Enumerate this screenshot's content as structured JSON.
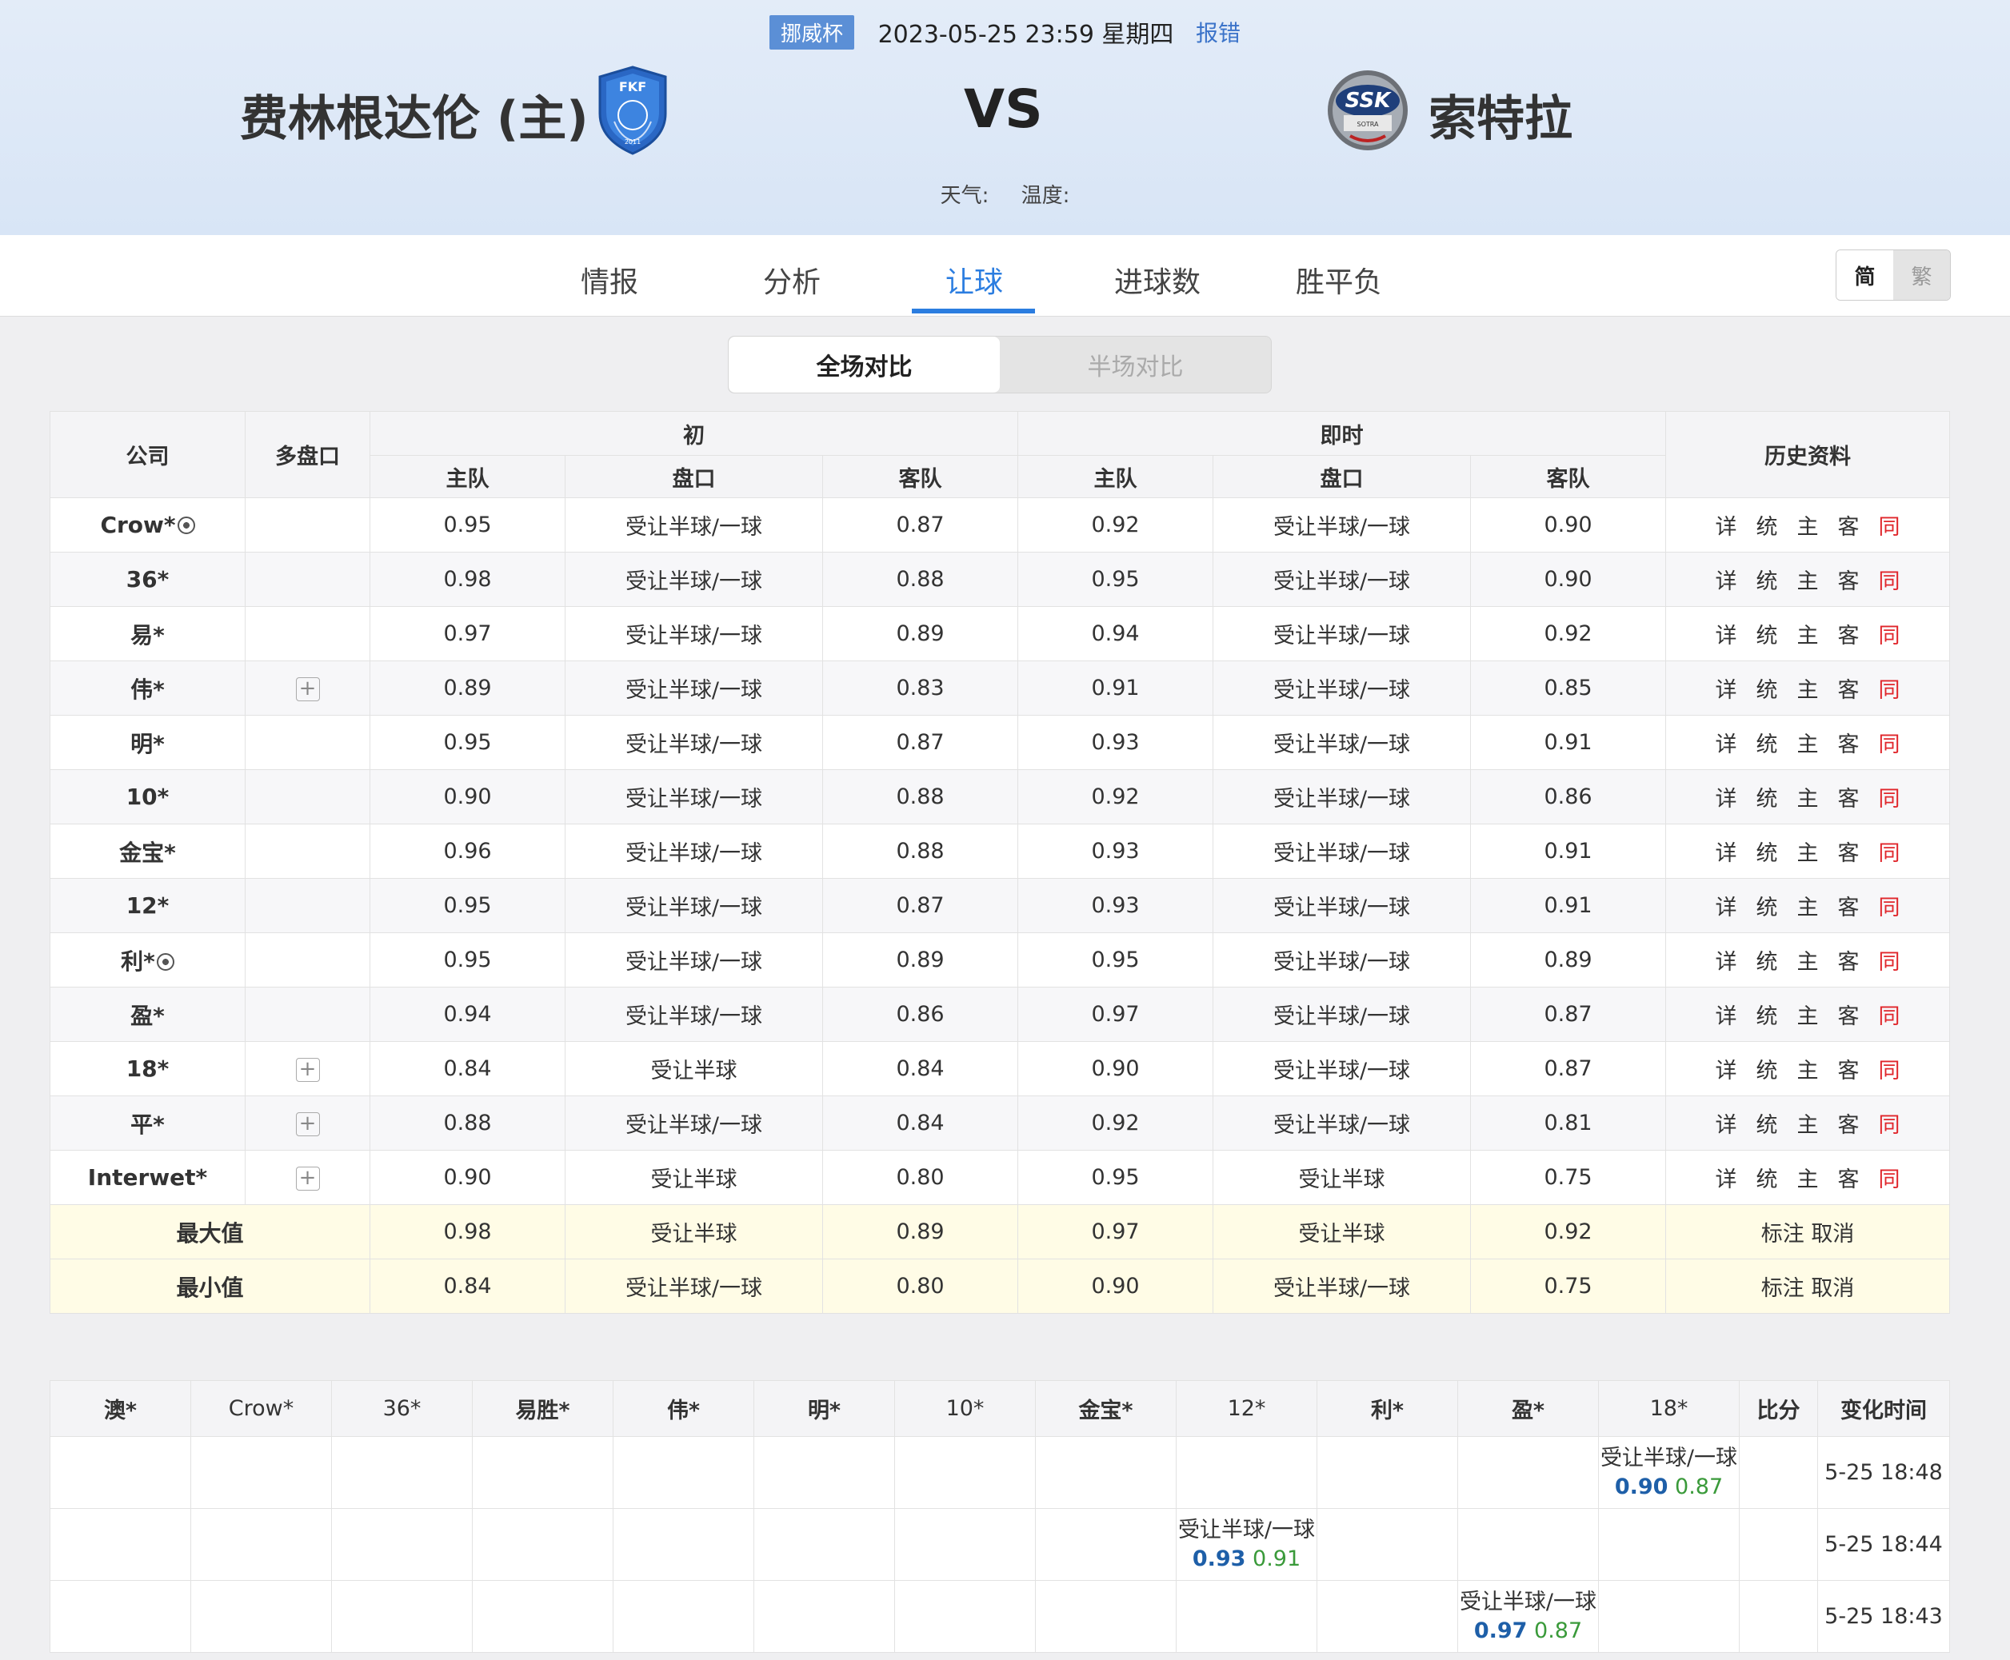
{
  "header": {
    "league": "挪威杯",
    "datetime": "2023-05-25 23:59 星期四",
    "report": "报错",
    "home_team": "费林根达伦 (主)",
    "away_team": "索特拉",
    "vs": "VS",
    "weather_label": "天气:",
    "temperature_label": "温度:"
  },
  "tabs": [
    "情报",
    "分析",
    "让球",
    "进球数",
    "胜平负"
  ],
  "active_tab": "让球",
  "lang": {
    "simplified": "简",
    "traditional": "繁"
  },
  "segment": {
    "full": "全场对比",
    "half": "半场对比"
  },
  "main_table": {
    "headers": {
      "company": "公司",
      "multi": "多盘口",
      "initial": "初",
      "live": "即时",
      "history": "历史资料",
      "home": "主队",
      "line": "盘口",
      "away": "客队"
    },
    "history_links": [
      "详",
      "统",
      "主",
      "客",
      "同"
    ],
    "rows": [
      {
        "company": "Crow*",
        "ball": true,
        "plus": false,
        "ih": "0.95",
        "il": "受让半球/一球",
        "ia": "0.87",
        "lh": "0.92",
        "ll": "受让半球/一球",
        "la": "0.90"
      },
      {
        "company": "36*",
        "ball": false,
        "plus": false,
        "ih": "0.98",
        "il": "受让半球/一球",
        "ia": "0.88",
        "lh": "0.95",
        "ll": "受让半球/一球",
        "la": "0.90"
      },
      {
        "company": "易*",
        "ball": false,
        "plus": false,
        "ih": "0.97",
        "il": "受让半球/一球",
        "ia": "0.89",
        "lh": "0.94",
        "ll": "受让半球/一球",
        "la": "0.92"
      },
      {
        "company": "伟*",
        "ball": false,
        "plus": true,
        "ih": "0.89",
        "il": "受让半球/一球",
        "ia": "0.83",
        "lh": "0.91",
        "ll": "受让半球/一球",
        "la": "0.85"
      },
      {
        "company": "明*",
        "ball": false,
        "plus": false,
        "ih": "0.95",
        "il": "受让半球/一球",
        "ia": "0.87",
        "lh": "0.93",
        "ll": "受让半球/一球",
        "la": "0.91"
      },
      {
        "company": "10*",
        "ball": false,
        "plus": false,
        "ih": "0.90",
        "il": "受让半球/一球",
        "ia": "0.88",
        "lh": "0.92",
        "ll": "受让半球/一球",
        "la": "0.86"
      },
      {
        "company": "金宝*",
        "ball": false,
        "plus": false,
        "ih": "0.96",
        "il": "受让半球/一球",
        "ia": "0.88",
        "lh": "0.93",
        "ll": "受让半球/一球",
        "la": "0.91"
      },
      {
        "company": "12*",
        "ball": false,
        "plus": false,
        "ih": "0.95",
        "il": "受让半球/一球",
        "ia": "0.87",
        "lh": "0.93",
        "ll": "受让半球/一球",
        "la": "0.91"
      },
      {
        "company": "利*",
        "ball": true,
        "plus": false,
        "ih": "0.95",
        "il": "受让半球/一球",
        "ia": "0.89",
        "lh": "0.95",
        "ll": "受让半球/一球",
        "la": "0.89"
      },
      {
        "company": "盈*",
        "ball": false,
        "plus": false,
        "ih": "0.94",
        "il": "受让半球/一球",
        "ia": "0.86",
        "lh": "0.97",
        "ll": "受让半球/一球",
        "la": "0.87"
      },
      {
        "company": "18*",
        "ball": false,
        "plus": true,
        "ih": "0.84",
        "il": "受让半球",
        "ia": "0.84",
        "lh": "0.90",
        "ll": "受让半球/一球",
        "la": "0.87"
      },
      {
        "company": "平*",
        "ball": false,
        "plus": true,
        "ih": "0.88",
        "il": "受让半球/一球",
        "ia": "0.84",
        "lh": "0.92",
        "ll": "受让半球/一球",
        "la": "0.81"
      },
      {
        "company": "Interwet*",
        "ball": false,
        "plus": true,
        "ih": "0.90",
        "il": "受让半球",
        "ia": "0.80",
        "lh": "0.95",
        "ll": "受让半球",
        "la": "0.75"
      }
    ],
    "summary": [
      {
        "label": "最大值",
        "ih": "0.98",
        "il": "受让半球",
        "ia": "0.89",
        "lh": "0.97",
        "ll": "受让半球",
        "la": "0.92"
      },
      {
        "label": "最小值",
        "ih": "0.84",
        "il": "受让半球/一球",
        "ia": "0.80",
        "lh": "0.90",
        "ll": "受让半球/一球",
        "la": "0.75"
      }
    ],
    "summary_actions": "标注 取消"
  },
  "change_table": {
    "headers": [
      "澳*",
      "Crow*",
      "36*",
      "易胜*",
      "伟*",
      "明*",
      "10*",
      "金宝*",
      "12*",
      "利*",
      "盈*",
      "18*",
      "比分",
      "变化时间"
    ],
    "rows": [
      {
        "col": 11,
        "line": "受让半球/一球",
        "home": "0.90",
        "away": "0.87",
        "time": "5-25 18:48"
      },
      {
        "col": 8,
        "line": "受让半球/一球",
        "home": "0.93",
        "away": "0.91",
        "time": "5-25 18:44"
      },
      {
        "col": 10,
        "line": "受让半球/一球",
        "home": "0.97",
        "away": "0.87",
        "time": "5-25 18:43"
      }
    ]
  },
  "colors": {
    "accent": "#2b7de0",
    "red_link": "#e0262b",
    "home_odds": "#1e5fa8",
    "away_odds": "#3a9a3a",
    "summary_bg": "#fffce6"
  }
}
